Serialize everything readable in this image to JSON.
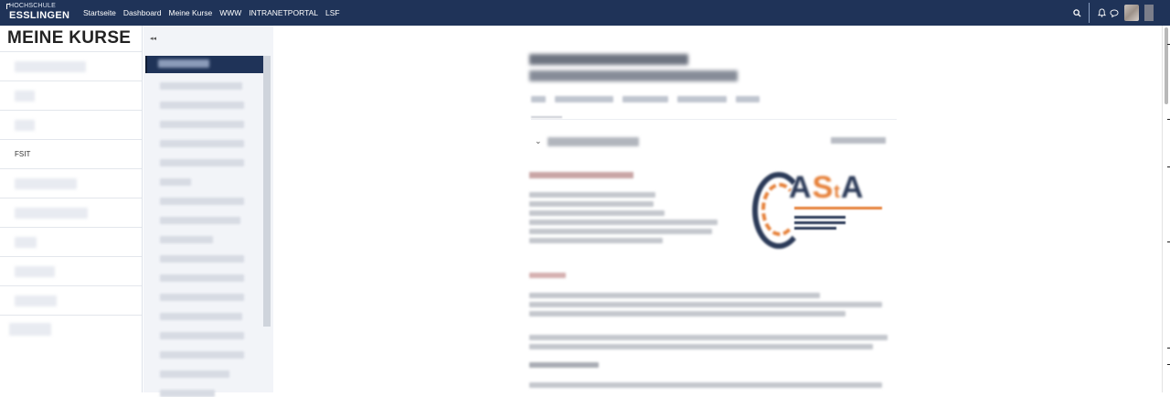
{
  "navbar": {
    "logo_line1": "HOCHSCHULE",
    "logo_line2": "ESSLINGEN",
    "links": [
      "Startseite",
      "Dashboard",
      "Meine Kurse",
      "WWW",
      "INTRANETPORTAL",
      "LSF"
    ],
    "icons": [
      "search-icon",
      "bell-icon",
      "chat-icon"
    ]
  },
  "left": {
    "title": "MEINE KURSE",
    "visible_course_label": "FSIT"
  },
  "middle": {
    "collapse_glyph": "◂◂"
  },
  "main": {
    "section_toggle_glyph": "⌄"
  },
  "logo_art": {
    "text_a": "A",
    "text_s": "S",
    "text_t": "t",
    "text_a2": "A"
  },
  "colors": {
    "navbar": "#1f3358",
    "accent": "#e6813a",
    "active_nav": "#1f3358"
  }
}
